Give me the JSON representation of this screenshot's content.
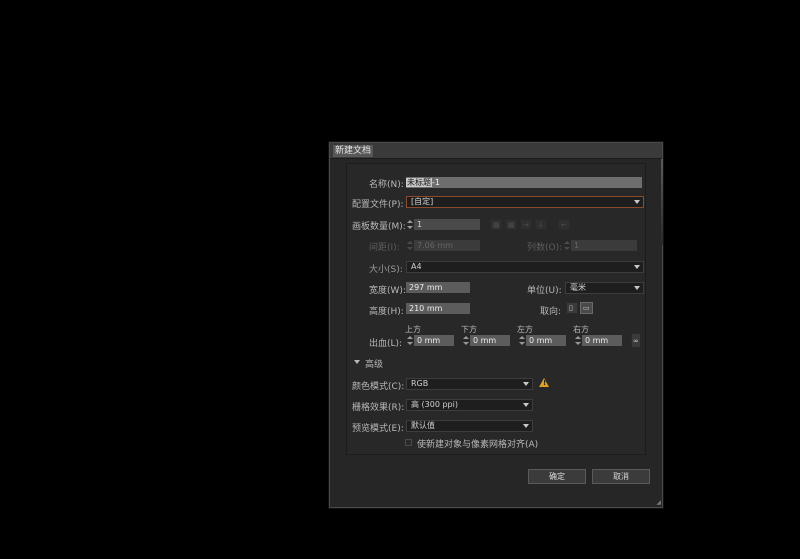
{
  "dialog": {
    "title": "新建文档"
  },
  "name": {
    "label": "名称(N):",
    "selected": "未标题",
    "rest": "-1"
  },
  "profile": {
    "label": "配置文件(P):",
    "value": "[自定]"
  },
  "artboards": {
    "label": "画板数量(M):",
    "value": "1"
  },
  "spacing": {
    "label": "间距(I):",
    "value": "7.06 mm"
  },
  "columns": {
    "label": "列数(O):",
    "value": "1"
  },
  "size": {
    "label": "大小(S):",
    "value": "A4"
  },
  "width": {
    "label": "宽度(W):",
    "value": "297 mm"
  },
  "units": {
    "label": "单位(U):",
    "value": "毫米"
  },
  "height": {
    "label": "高度(H):",
    "value": "210 mm"
  },
  "orientation": {
    "label": "取向:"
  },
  "bleed": {
    "label": "出血(L):",
    "top_label": "上方",
    "bottom_label": "下方",
    "left_label": "左方",
    "right_label": "右方",
    "top": "0 mm",
    "bottom": "0 mm",
    "left": "0 mm",
    "right": "0 mm"
  },
  "advanced": {
    "label": "高级"
  },
  "color_mode": {
    "label": "颜色模式(C):",
    "value": "RGB"
  },
  "raster": {
    "label": "栅格效果(R):",
    "value": "高 (300 ppi)"
  },
  "preview": {
    "label": "预览模式(E):",
    "value": "默认值"
  },
  "align_pixel": {
    "label": "使新建对象与像素网格对齐(A)"
  },
  "buttons": {
    "ok": "确定",
    "cancel": "取消"
  },
  "icons": {
    "warning": "warning-icon",
    "link": "chain-link-icon",
    "portrait": "portrait-icon",
    "landscape": "landscape-icon"
  }
}
